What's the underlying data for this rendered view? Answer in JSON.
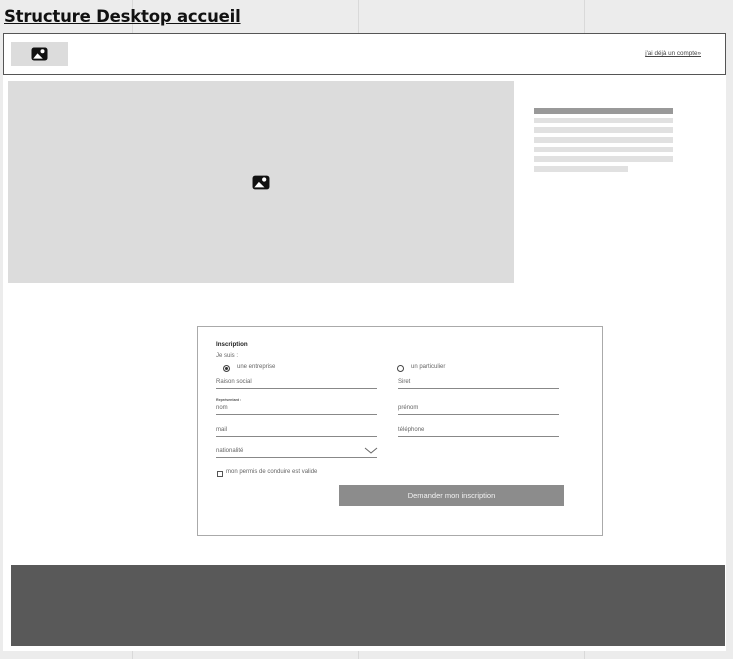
{
  "page": {
    "title": "Structure Desktop accueil"
  },
  "header": {
    "logo_icon": "image-placeholder-icon",
    "account_link": "j'ai déjà un compte»"
  },
  "hero": {
    "icon": "image-placeholder-icon"
  },
  "form": {
    "title": "Inscription",
    "intro": "Je suis :",
    "options": [
      {
        "label": "une entreprise",
        "selected": true
      },
      {
        "label": "un particulier",
        "selected": false
      }
    ],
    "fields": {
      "raison_social": "Raison social",
      "siret": "Siret",
      "representant_label": "Représentant :",
      "nom": "nom",
      "prenom": "prénom",
      "mail": "mail",
      "telephone": "téléphone",
      "nationalite": "nationalité"
    },
    "checkbox_label": "mon permis de conduire est valide",
    "submit_label": "Demander mon inscription"
  },
  "colors": {
    "background": "#ececec",
    "placeholder": "#dcdcdc",
    "button": "#8c8c8c",
    "footer": "#595959"
  }
}
